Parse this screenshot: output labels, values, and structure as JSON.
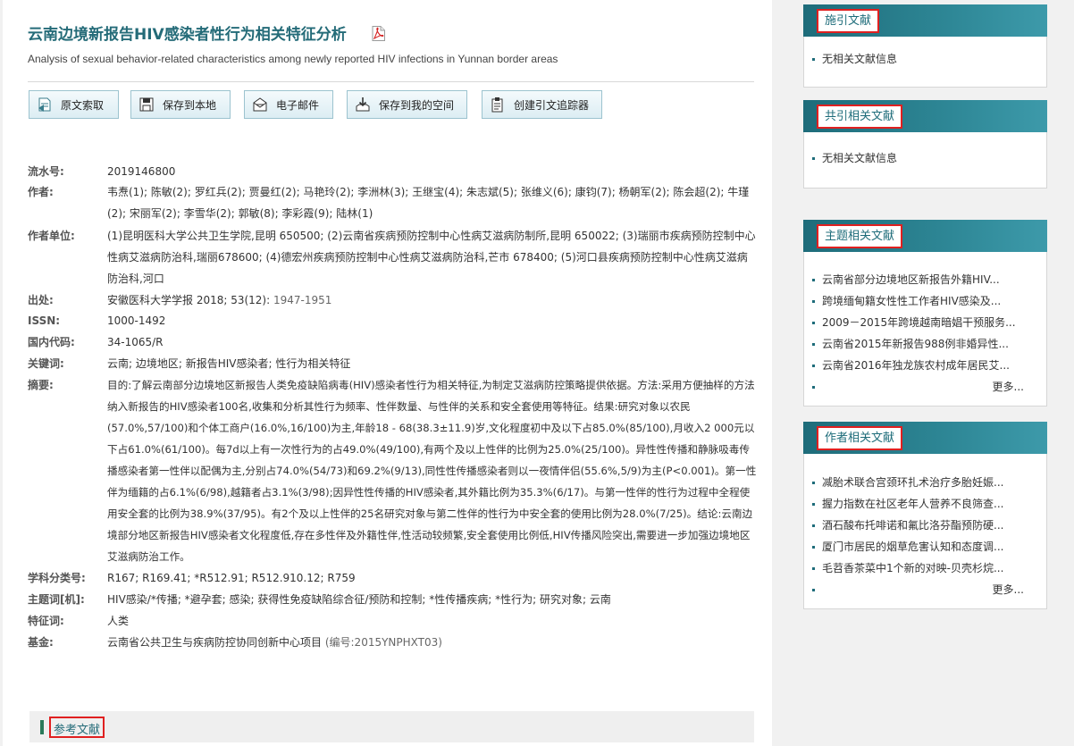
{
  "article": {
    "title": "云南边境新报告HIV感染者性行为相关特征分析",
    "subtitle": "Analysis of sexual behavior-related characteristics among newly reported HIV infections in Yunnan border areas"
  },
  "toolbar": [
    {
      "label": "原文索取",
      "icon": "document-request-icon"
    },
    {
      "label": "保存到本地",
      "icon": "floppy-save-icon"
    },
    {
      "label": "电子邮件",
      "icon": "envelope-icon"
    },
    {
      "label": "保存到我的空间",
      "icon": "download-tray-icon"
    },
    {
      "label": "创建引文追踪器",
      "icon": "clipboard-icon"
    }
  ],
  "fields": {
    "serial_label": "流水号:",
    "serial": "2019146800",
    "authors_label": "作者:",
    "authors": "韦焘(1); 陈敏(2); 罗红兵(2); 贾曼红(2); 马艳玲(2); 李洲林(3); 王继宝(4); 朱志斌(5); 张维义(6); 康钧(7); 杨朝军(2); 陈会超(2); 牛瑾(2); 宋丽军(2); 李雪华(2); 郭敏(8); 李彩霞(9); 陆林(1)",
    "affil_label": "作者单位:",
    "affil": "(1)昆明医科大学公共卫生学院,昆明 650500; (2)云南省疾病预防控制中心性病艾滋病防制所,昆明 650022; (3)瑞丽市疾病预防控制中心性病艾滋病防治科,瑞丽678600; (4)德宏州疾病预防控制中心性病艾滋病防治科,芒市 678400; (5)河口县疾病预防控制中心性病艾滋病防治科,河口",
    "source_label": "出处:",
    "source_journal": "安徽医科大学学报  2018; 53(12):",
    "source_pages": " 1947-1951",
    "issn_label": "ISSN:",
    "issn": "1000-1492",
    "cn_label": "国内代码:",
    "cn": "34-1065/R",
    "keywords_label": "关键词:",
    "keywords": "云南;  边境地区;  新报告HIV感染者;  性行为相关特征",
    "abstract_label": "摘要:",
    "abstract": "目的:了解云南部分边境地区新报告人类免疫缺陷病毒(HIV)感染者性行为相关特征,为制定艾滋病防控策略提供依据。方法:采用方便抽样的方法纳入新报告的HIV感染者100名,收集和分析其性行为频率、性伴数量、与性伴的关系和安全套使用等特征。结果:研究对象以农民(57.0%,57/100)和个体工商户(16.0%,16/100)为主,年龄18 - 68(38.3±11.9)岁,文化程度初中及以下占85.0%(85/100),月收入2 000元以下占61.0%(61/100)。每7d以上有一次性行为的占49.0%(49/100),有两个及以上性伴的比例为25.0%(25/100)。异性性传播和静脉吸毒传播感染者第一性伴以配偶为主,分别占74.0%(54/73)和69.2%(9/13),同性性传播感染者则以一夜情伴侣(55.6%,5/9)为主(P<0.001)。第一性伴为缅籍的占6.1%(6/98),越籍者占3.1%(3/98);因异性性传播的HIV感染者,其外籍比例为35.3%(6/17)。与第一性伴的性行为过程中全程使用安全套的比例为38.9%(37/95)。有2个及以上性伴的25名研究对象与第二性伴的性行为中安全套的使用比例为28.0%(7/25)。结论:云南边境部分地区新报告HIV感染者文化程度低,存在多性伴及外籍性伴,性活动较频繁,安全套使用比例低,HIV传播风险突出,需要进一步加强边境地区艾滋病防治工作。",
    "class_label": "学科分类号:",
    "class": "R167; R169.41; *R512.91; R512.910.12; R759",
    "subject_label": "主题词[机]:",
    "subject": "HIV感染/*传播; *避孕套; 感染; 获得性免疫缺陷综合征/预防和控制; *性传播疾病; *性行为; 研究对象; 云南",
    "feature_label": "特征词:",
    "feature": "人类",
    "fund_label": "基金:",
    "fund_name": "云南省公共卫生与疾病防控协同创新中心项目",
    "fund_code": " (编号:2015YNPHXT03)"
  },
  "references": {
    "title": "参考文献"
  },
  "sidebar": {
    "more_label": "更多...",
    "citing": {
      "title": "施引文献",
      "items": [
        "无相关文献信息"
      ]
    },
    "cocited": {
      "title": "共引相关文献",
      "items": [
        "无相关文献信息"
      ]
    },
    "topic": {
      "title": "主题相关文献",
      "items": [
        "云南省部分边境地区新报告外籍HIV...",
        "跨境缅甸籍女性性工作者HIV感染及...",
        "2009－2015年跨境越南暗娼干预服务...",
        "云南省2015年新报告988例非婚异性...",
        "云南省2016年独龙族农村成年居民艾..."
      ]
    },
    "author": {
      "title": "作者相关文献",
      "items": [
        "减胎术联合宫颈环扎术治疗多胎妊娠...",
        "握力指数在社区老年人营养不良筛查...",
        "酒石酸布托啡诺和氟比洛芬酯预防硬...",
        "厦门市居民的烟草危害认知和态度调...",
        "毛苕香茶菜中1个新的对映-贝壳杉烷..."
      ]
    }
  }
}
